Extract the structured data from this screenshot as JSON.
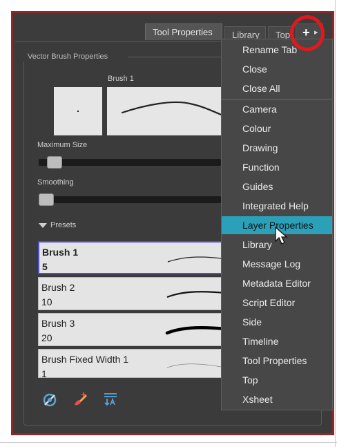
{
  "tabs": {
    "active": "Tool Properties",
    "second": "Library",
    "third": "Top"
  },
  "add_tab": {
    "plus": "+",
    "arrow": "▸"
  },
  "panel": {
    "group_title": "Vector Brush Properties",
    "brush_name": "Brush 1",
    "max_size_label": "Maximum Size",
    "max_size_fraction": 0.05,
    "smoothing_label": "Smoothing",
    "smoothing_fraction": 0.0,
    "presets_label": "Presets"
  },
  "presets": [
    {
      "name": "Brush 1",
      "size": "5"
    },
    {
      "name": "Brush 2",
      "size": "10"
    },
    {
      "name": "Brush 3",
      "size": "20"
    },
    {
      "name": "Brush Fixed Width 1",
      "size": "1"
    }
  ],
  "menu": {
    "group1": [
      "Rename Tab",
      "Close",
      "Close All"
    ],
    "group2": [
      "Camera",
      "Colour",
      "Drawing",
      "Function",
      "Guides",
      "Integrated Help",
      "Layer Properties",
      "Library",
      "Message Log",
      "Metadata Editor",
      "Script Editor",
      "Side",
      "Timeline",
      "Tool Properties",
      "Top",
      "Xsheet"
    ],
    "highlighted": "Layer Properties"
  },
  "colors": {
    "highlight": "#2aa1b9",
    "annotation_circle": "#e0191d",
    "frame_border": "#8a2a2a",
    "selected_preset_border": "#4d4fd6"
  },
  "bottom_icons": [
    "create-preset-icon",
    "new-brush-icon",
    "import-export-icon"
  ]
}
